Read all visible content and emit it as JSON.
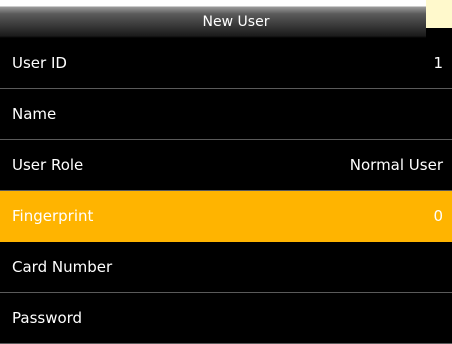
{
  "header": {
    "title": "New User"
  },
  "menu": {
    "items": [
      {
        "label": "User ID",
        "value": "1"
      },
      {
        "label": "Name",
        "value": ""
      },
      {
        "label": "User Role",
        "value": "Normal User"
      },
      {
        "label": "Fingerprint",
        "value": "0"
      },
      {
        "label": "Card Number",
        "value": ""
      },
      {
        "label": "Password",
        "value": ""
      }
    ],
    "selected_label": "Fingerprint"
  },
  "colors": {
    "background": "#000000",
    "selection": "#ffb400",
    "text": "#ffffff",
    "divider": "#5a5a5a"
  }
}
